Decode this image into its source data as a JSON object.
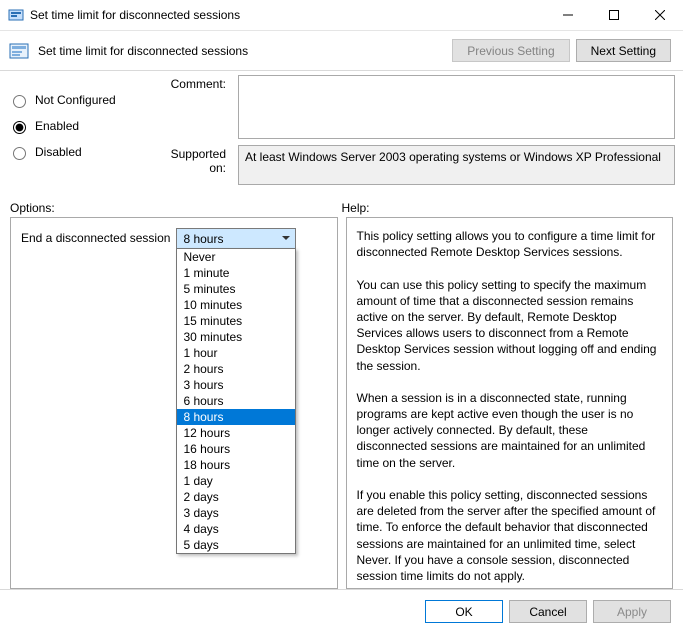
{
  "window": {
    "title": "Set time limit for disconnected sessions"
  },
  "header": {
    "subtitle": "Set time limit for disconnected sessions",
    "previous": "Previous Setting",
    "next": "Next Setting"
  },
  "state": {
    "not_configured": "Not Configured",
    "enabled": "Enabled",
    "disabled": "Disabled",
    "selected": "enabled"
  },
  "comment": {
    "label": "Comment:",
    "value": ""
  },
  "supported": {
    "label": "Supported on:",
    "value": "At least Windows Server 2003 operating systems or Windows XP Professional"
  },
  "labels": {
    "options": "Options:",
    "help": "Help:"
  },
  "options": {
    "field_label": "End a disconnected session",
    "selected": "8 hours",
    "items": [
      "Never",
      "1 minute",
      "5 minutes",
      "10 minutes",
      "15 minutes",
      "30 minutes",
      "1 hour",
      "2 hours",
      "3 hours",
      "6 hours",
      "8 hours",
      "12 hours",
      "16 hours",
      "18 hours",
      "1 day",
      "2 days",
      "3 days",
      "4 days",
      "5 days"
    ]
  },
  "help": {
    "text": "This policy setting allows you to configure a time limit for disconnected Remote Desktop Services sessions.\n\nYou can use this policy setting to specify the maximum amount of time that a disconnected session remains active on the server. By default, Remote Desktop Services allows users to disconnect from a Remote Desktop Services session without logging off and ending the session.\n\nWhen a session is in a disconnected state, running programs are kept active even though the user is no longer actively connected. By default, these disconnected sessions are maintained for an unlimited time on the server.\n\nIf you enable this policy setting, disconnected sessions are deleted from the server after the specified amount of time. To enforce the default behavior that disconnected sessions are maintained for an unlimited time, select Never. If you have a console session, disconnected session time limits do not apply."
  },
  "footer": {
    "ok": "OK",
    "cancel": "Cancel",
    "apply": "Apply"
  }
}
